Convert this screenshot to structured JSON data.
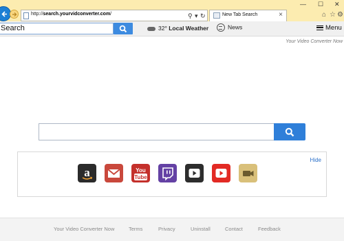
{
  "browser": {
    "url_prefix": "http://",
    "url_domain": "search.yourvidconverter.com",
    "url_suffix": "/",
    "tab_title": "New Tab Search",
    "close": "×",
    "search_glyph": "⚲",
    "dropdown_glyph": "▾",
    "refresh_glyph": "↻",
    "min_glyph": "—",
    "max_glyph": "☐",
    "window_close_glyph": "✕",
    "home_glyph": "⌂",
    "star_glyph": "☆",
    "gear_glyph": "⚙"
  },
  "toolbar": {
    "search_placeholder": "Search",
    "weather_temp": "32°",
    "weather_label": "Local Weather",
    "news_label": "News",
    "menu_label": "Menu"
  },
  "page": {
    "brand_tag": "Your Video Converter Now",
    "hide_label": "Hide",
    "tiles": [
      {
        "name": "amazon",
        "color": "#2b2b2b",
        "icon": "amazon-icon"
      },
      {
        "name": "gmail",
        "color": "#c9483c",
        "icon": "gmail-icon"
      },
      {
        "name": "youtube-logo",
        "color": "#c4302b",
        "icon": "youtube-icon",
        "text": "You Tube"
      },
      {
        "name": "twitch",
        "color": "#6441a4",
        "icon": "twitch-icon"
      },
      {
        "name": "video-player",
        "color": "#2d2d2d",
        "icon": "play-icon"
      },
      {
        "name": "youtube-play",
        "color": "#e22a24",
        "icon": "play-icon"
      },
      {
        "name": "video-converter",
        "color": "#d9c07a",
        "icon": "camera-icon"
      }
    ]
  },
  "footer": {
    "links": [
      "Your Video Converter Now",
      "Terms",
      "Privacy",
      "Uninstall",
      "Contact",
      "Feedback"
    ]
  }
}
